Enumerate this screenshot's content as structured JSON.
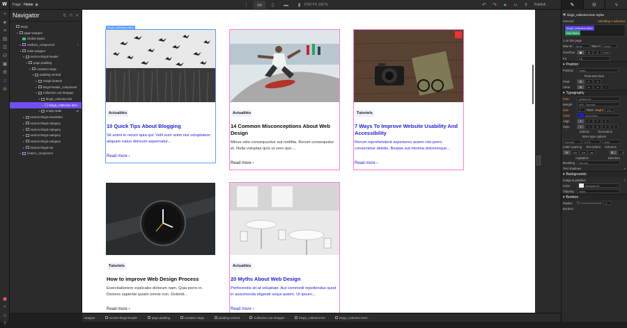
{
  "topbar": {
    "logo": "W",
    "page_label": "Page:",
    "page_name": "Home",
    "size_info": "1700 PX  100 %",
    "publish_label": "Publish"
  },
  "navigator": {
    "title": "Navigator",
    "tree": [
      {
        "label": "Body",
        "indent": 0,
        "caret": "",
        "kind": "normal"
      },
      {
        "label": "page-wrapper",
        "indent": 1,
        "caret": "▾",
        "kind": "normal"
      },
      {
        "label": "Global Styles",
        "indent": 2,
        "caret": "",
        "kind": "green"
      },
      {
        "label": "navbar1_component",
        "indent": 2,
        "caret": "▸",
        "kind": "purple",
        "plus": "+"
      },
      {
        "label": "main-wrapper",
        "indent": 2,
        "caret": "▾",
        "kind": "normal"
      },
      {
        "label": "section-blog3-header",
        "indent": 3,
        "caret": "▾",
        "kind": "normal"
      },
      {
        "label": "page-padding",
        "indent": 4,
        "caret": "▾",
        "kind": "normal"
      },
      {
        "label": "container-large",
        "indent": 5,
        "caret": "▾",
        "kind": "normal"
      },
      {
        "label": "padding-vertical",
        "indent": 6,
        "caret": "▾",
        "kind": "normal"
      },
      {
        "label": "margin-bottom",
        "indent": 7,
        "caret": "▸",
        "kind": "normal"
      },
      {
        "label": "blog3-header_component",
        "indent": 7,
        "caret": "▸",
        "kind": "normal"
      },
      {
        "label": "Collection List Wrapper",
        "indent": 7,
        "caret": "▾",
        "kind": "normal"
      },
      {
        "label": "blog3_collection-list",
        "indent": 8,
        "caret": "▾",
        "kind": "normal"
      },
      {
        "label": "blog3_collection-item",
        "indent": 9,
        "caret": "▸",
        "kind": "sel"
      },
      {
        "label": "empty-state",
        "indent": 8,
        "caret": "▸",
        "kind": "normal",
        "plus": "⇄"
      },
      {
        "label": "section-blog3-newsletter",
        "indent": 3,
        "caret": "▸",
        "kind": "normal"
      },
      {
        "label": "section-blog3-category",
        "indent": 3,
        "caret": "▸",
        "kind": "normal"
      },
      {
        "label": "section-blog3-category",
        "indent": 3,
        "caret": "▸",
        "kind": "normal"
      },
      {
        "label": "section-blog3-category",
        "indent": 3,
        "caret": "▸",
        "kind": "normal"
      },
      {
        "label": "section-blog3-category",
        "indent": 3,
        "caret": "▸",
        "kind": "normal"
      },
      {
        "label": "section-blog3-cta",
        "indent": 3,
        "caret": "▸",
        "kind": "normal"
      },
      {
        "label": "footer1_component",
        "indent": 2,
        "caret": "▸",
        "kind": "purple"
      }
    ]
  },
  "canvas": {
    "selected_label": "blog3_collection-item",
    "cards": [
      {
        "category": "Actualités",
        "title": "10 Quick Tips About Blogging",
        "desc": "Sit animi in rerum quia qui. Velit eum enim nisi voluptatem aliquam natus dolorum aspernatur...",
        "read_more": "Read more",
        "image": "birds-field",
        "blue": true,
        "selected": true
      },
      {
        "category": "Actualités",
        "title": "14 Common Misconceptions About Web Design",
        "desc": "Minus odio consequuntur aut mollitia. Rerum consequatur et. Nulla voluptas quis ut vero quo....",
        "read_more": "Read more",
        "image": "skateboarder",
        "blue": false,
        "selected": false
      },
      {
        "category": "Tutoriels",
        "title": "7 Ways To Improve Website Usability And Accessibility",
        "desc": "Rerum reprehenderit asperiores autem nisi porro consectetur debitis. Beatae aut minima doloremque...",
        "read_more": "Read more",
        "image": "camera-desk",
        "blue": true,
        "selected": false
      },
      {
        "category": "Tutoriels",
        "title": "How to improve Web Design Process",
        "desc": "Exercitationem explicabo dolorum nam. Quia porro in. Dolores sapiente ipsam omnis non. Deleniti...",
        "read_more": "Read more",
        "image": "watch",
        "blue": false,
        "selected": false
      },
      {
        "category": "Actualités",
        "title": "20 Myths About Web Design",
        "desc": "Perferendis sit at voluptate. Aut commodi repellendus quod in assumenda eligendi sequi autem. Ut ipsum...",
        "read_more": "Read more",
        "image": "cafe",
        "blue": true,
        "selected": false
      }
    ]
  },
  "breadcrumb": [
    "wrapper",
    "section-blog3-header",
    "page-padding",
    "container-large",
    "padding-vertical",
    "Collection List Wrapper",
    "blog3_collection-list",
    "blog3_collection-item"
  ],
  "style_panel": {
    "element_name": "blog3_collection-item Styles",
    "selector_label": "Selector",
    "inheriting": "Inheriting 2 selectors",
    "class_chip": "blog3_collection-item",
    "state_chip": "Grid Items",
    "on_page": "1 on this page",
    "max_w": "Max W",
    "max_h": "Max H",
    "none": "None",
    "overflow": "Overflow",
    "fit": "Fit",
    "fill": "Fill",
    "auto": "Auto",
    "position_section": "Position",
    "position_label": "Position",
    "position_value": "Static",
    "float_clear": "Float and clear",
    "float_label": "Float",
    "clear_label": "Clear",
    "typography_section": "Typography",
    "font_label": "Font",
    "font_value": "system-ui",
    "weight_label": "Weight",
    "weight_value": "400 - Normal",
    "size_label": "Size",
    "size_value": "1",
    "size_unit": "REM",
    "height_label": "Height",
    "height_value": "1.5",
    "color_label": "Color",
    "color_value": "#1D1DD8",
    "align_label": "Align",
    "style_label": "Style",
    "italicize": "Italicize",
    "decoration": "Decoration",
    "more_type": "More type options",
    "letter_spacing": "Letter spacing",
    "text_indent": "Text indent",
    "columns": "Columns",
    "capitalize": "Capitalize",
    "direction": "Direction",
    "breaking_label": "Breaking",
    "breaking_value": "Normal",
    "text_shadows": "Text shadows",
    "backgrounds_section": "Backgrounds",
    "image_gradient": "Image & gradient",
    "bg_color_label": "Color",
    "bg_color_value": "transparent",
    "clipping_label": "Clipping",
    "clipping_value": "None",
    "borders_section": "Borders",
    "radius_label": "Radius",
    "radius_value": "0",
    "borders_label": "Borders",
    "accent": "#6f4ff2",
    "text_blue": "#1d1dd8"
  }
}
